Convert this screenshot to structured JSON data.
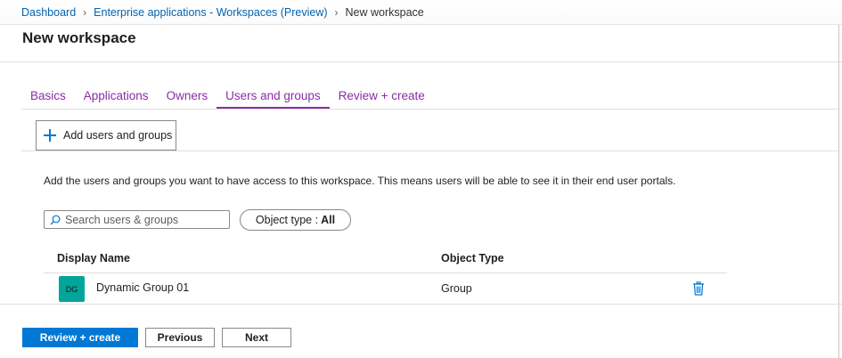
{
  "breadcrumb": {
    "items": [
      "Dashboard",
      "Enterprise applications - Workspaces (Preview)"
    ],
    "current": "New workspace"
  },
  "page_title": "New workspace",
  "tabs": [
    {
      "label": "Basics"
    },
    {
      "label": "Applications"
    },
    {
      "label": "Owners"
    },
    {
      "label": "Users and groups",
      "active": true
    },
    {
      "label": "Review + create"
    }
  ],
  "toolbar": {
    "add_label": "Add users and groups"
  },
  "description": "Add the users and groups you want to have access to this workspace. This means users will be able to see it in their end user portals.",
  "search": {
    "placeholder": "Search users & groups",
    "value": ""
  },
  "filter": {
    "label": "Object type :",
    "value": "All"
  },
  "table": {
    "columns": [
      "Display Name",
      "Object Type"
    ],
    "rows": [
      {
        "initials": "DG",
        "name": "Dynamic Group 01",
        "type": "Group"
      }
    ]
  },
  "footer": {
    "review_label": "Review + create",
    "previous_label": "Previous",
    "next_label": "Next"
  },
  "colors": {
    "accent": "#0078d4",
    "tab": "#8a2da5",
    "avatar": "#03a59a"
  }
}
